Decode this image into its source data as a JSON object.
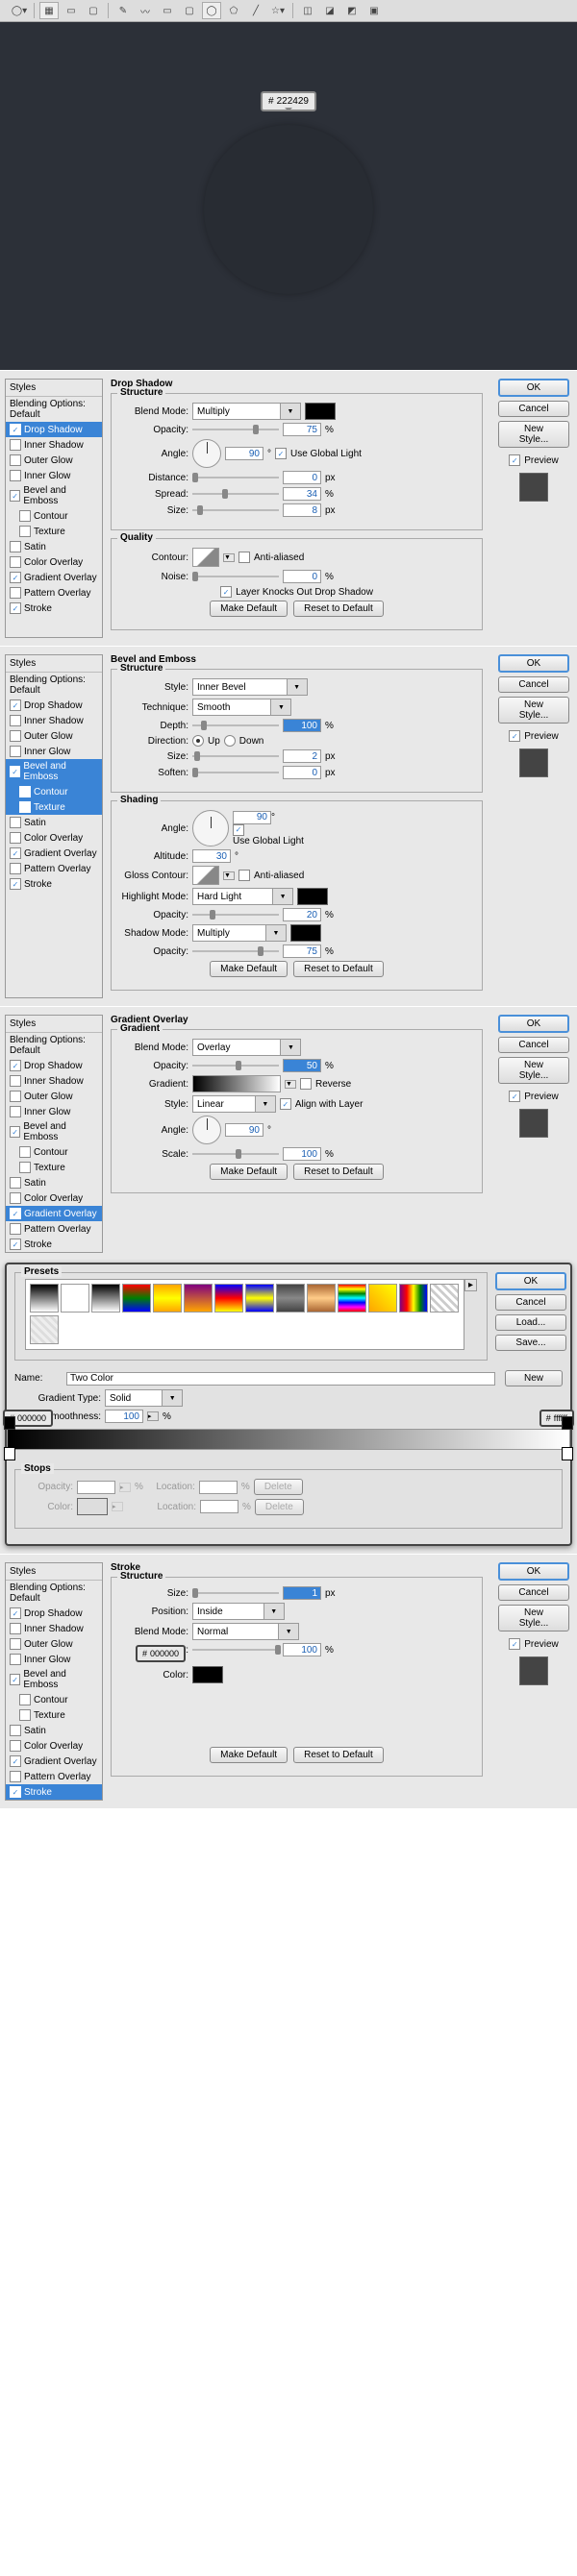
{
  "swatch1": "222429",
  "styles_header": "Styles",
  "blending_opts": "Blending Options: Default",
  "effects": [
    "Drop Shadow",
    "Inner Shadow",
    "Outer Glow",
    "Inner Glow",
    "Bevel and Emboss",
    "Contour",
    "Texture",
    "Satin",
    "Color Overlay",
    "Gradient Overlay",
    "Pattern Overlay",
    "Stroke"
  ],
  "buttons": {
    "ok": "OK",
    "cancel": "Cancel",
    "newstyle": "New Style...",
    "preview": "Preview",
    "makedef": "Make Default",
    "reset": "Reset to Default",
    "load": "Load...",
    "save": "Save...",
    "new": "New",
    "delete": "Delete"
  },
  "labels": {
    "blendmode": "Blend Mode:",
    "opacity": "Opacity:",
    "angle": "Angle:",
    "useglobal": "Use Global Light",
    "distance": "Distance:",
    "spread": "Spread:",
    "size": "Size:",
    "contour": "Contour:",
    "antialiased": "Anti-aliased",
    "noise": "Noise:",
    "knock": "Layer Knocks Out Drop Shadow",
    "style": "Style:",
    "technique": "Technique:",
    "depth": "Depth:",
    "direction": "Direction:",
    "up": "Up",
    "down": "Down",
    "soften": "Soften:",
    "altitude": "Altitude:",
    "gloss": "Gloss Contour:",
    "highlight": "Highlight Mode:",
    "shadow": "Shadow Mode:",
    "gradient": "Gradient:",
    "reverse": "Reverse",
    "align": "Align with Layer",
    "scale": "Scale:",
    "position": "Position:",
    "color": "Color:",
    "name": "Name:",
    "gtype": "Gradient Type:",
    "smooth": "Smoothness:",
    "location": "Location:"
  },
  "sections": {
    "dropshadow": "Drop Shadow",
    "structure": "Structure",
    "quality": "Quality",
    "bevel": "Bevel and Emboss",
    "shading": "Shading",
    "goverlay": "Gradient Overlay",
    "gradient": "Gradient",
    "stroke": "Stroke",
    "presets": "Presets",
    "stops": "Stops"
  },
  "values": {
    "multiply": "Multiply",
    "op75": "75",
    "deg90": "90",
    "dist0": "0",
    "spread34": "34",
    "size8": "8",
    "noise0": "0",
    "innerbevel": "Inner Bevel",
    "smooth": "Smooth",
    "depth100": "100",
    "size2": "2",
    "soften0": "0",
    "alt30": "30",
    "hardlight": "Hard Light",
    "op20": "20",
    "overlay": "Overlay",
    "op50": "50",
    "linear": "Linear",
    "scale100": "100",
    "size1": "1",
    "inside": "Inside",
    "normal": "Normal",
    "op100": "100",
    "twocolor": "Two Color",
    "solid": "Solid",
    "sm100": "100"
  },
  "units": {
    "px": "px",
    "pct": "%",
    "deg": "°"
  },
  "hex": {
    "black": "000000",
    "white": "ffffff"
  }
}
